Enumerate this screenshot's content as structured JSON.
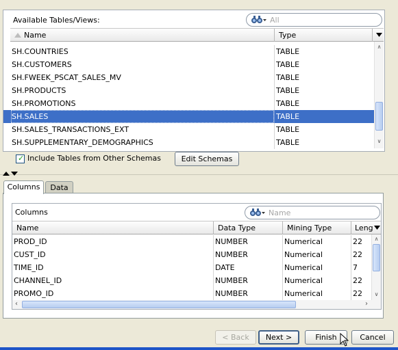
{
  "tables_panel": {
    "title": "Available Tables/Views:",
    "filter_placeholder": "All",
    "columns": [
      "Name",
      "Type"
    ],
    "rows": [
      {
        "name": "SH.COUNTRIES",
        "type": "TABLE"
      },
      {
        "name": "SH.CUSTOMERS",
        "type": "TABLE"
      },
      {
        "name": "SH.FWEEK_PSCAT_SALES_MV",
        "type": "TABLE"
      },
      {
        "name": "SH.PRODUCTS",
        "type": "TABLE"
      },
      {
        "name": "SH.PROMOTIONS",
        "type": "TABLE"
      },
      {
        "name": "SH.SALES",
        "type": "TABLE"
      },
      {
        "name": "SH.SALES_TRANSACTIONS_EXT",
        "type": "TABLE"
      },
      {
        "name": "SH.SUPPLEMENTARY_DEMOGRAPHICS",
        "type": "TABLE"
      }
    ],
    "selected_row": "SH.SALES",
    "include_other_schemas_label": "Include Tables from Other Schemas",
    "include_other_schemas_checked": true,
    "edit_schemas_label": "Edit Schemas"
  },
  "tabs": [
    {
      "label": "Columns",
      "active": true
    },
    {
      "label": "Data",
      "active": false
    }
  ],
  "columns_panel": {
    "title": "Columns",
    "filter_placeholder": "Name",
    "headers": [
      "Name",
      "Data Type",
      "Mining Type",
      "Lengt"
    ],
    "rows": [
      {
        "name": "PROD_ID",
        "data_type": "NUMBER",
        "mining_type": "Numerical",
        "length": "22"
      },
      {
        "name": "CUST_ID",
        "data_type": "NUMBER",
        "mining_type": "Numerical",
        "length": "22"
      },
      {
        "name": "TIME_ID",
        "data_type": "DATE",
        "mining_type": "Numerical",
        "length": "7"
      },
      {
        "name": "CHANNEL_ID",
        "data_type": "NUMBER",
        "mining_type": "Numerical",
        "length": "22"
      },
      {
        "name": "PROMO_ID",
        "data_type": "NUMBER",
        "mining_type": "Numerical",
        "length": "22"
      }
    ]
  },
  "footer": {
    "back_label": "< Back",
    "next_label": "Next >",
    "finish_label": "Finish",
    "cancel_label": "Cancel"
  },
  "colors": {
    "selection": "#3d6fc7",
    "dialog_bg": "#ece9d8"
  }
}
